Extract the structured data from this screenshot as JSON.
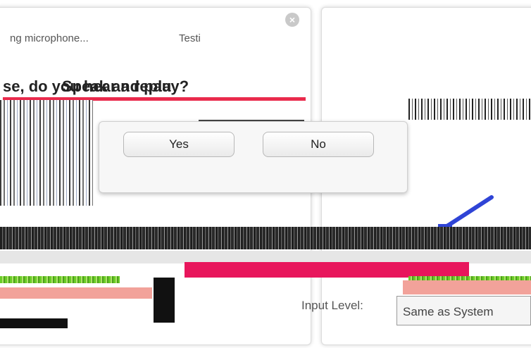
{
  "left_panel": {
    "status_text": "ng microphone...",
    "heading": "se, do you hear a replay?",
    "dialog": {
      "yes_label": "Yes",
      "no_label": "No"
    }
  },
  "right_panel": {
    "status_text": "Testi",
    "heading": "Speak and pau"
  },
  "input": {
    "label": "Input Level:",
    "selected": "Same as System"
  },
  "colors": {
    "accent_red": "#ea2a4c",
    "accent_pink": "#e8165c",
    "accent_blue": "#2f44d6",
    "accent_green": "#6acd27"
  }
}
